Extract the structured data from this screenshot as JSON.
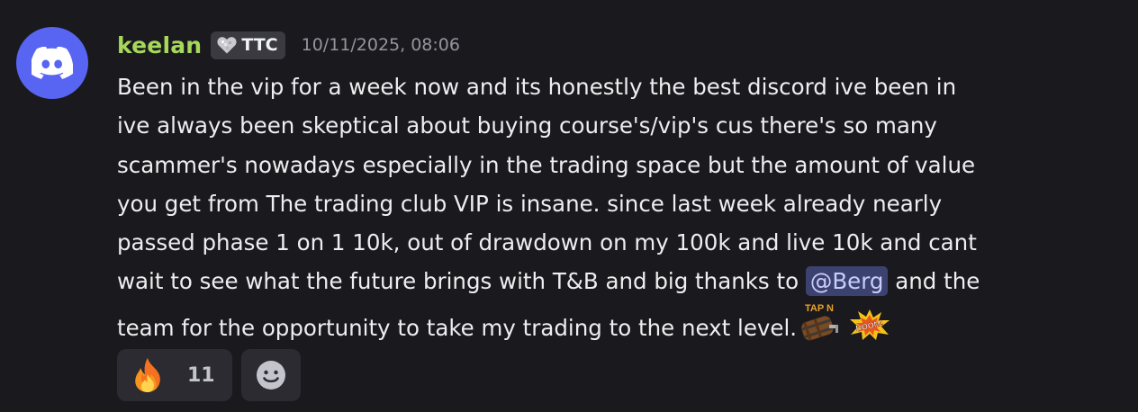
{
  "author": {
    "username": "keelan",
    "avatar_icon": "discord-logo-icon",
    "username_color": "#a6d85a",
    "avatar_color": "#5865f2"
  },
  "guild_tag": {
    "icon": "heart-badge-icon",
    "label": "TTC"
  },
  "timestamp": "10/11/2025, 08:06",
  "message": {
    "line1": "Been in the vip for a week now and its honestly the best discord ive been in",
    "line2": "ive always been skeptical about buying course's/vip's cus there's so many",
    "line3": "scammer's nowadays especially in the trading space but the amount of value",
    "line4": "you get from The trading club VIP is insane. since last week already nearly",
    "line5": "passed phase 1 on 1 10k, out of drawdown on my 100k and live 10k and cant",
    "line6_before": "wait to see what the future brings with T&B and big thanks to ",
    "mention": "@Berg",
    "line6_after": " and the",
    "line7": "team for the opportunity to take my trading to the next level.",
    "custom_emojis": [
      {
        "name": "tap-n-barrel-emoji",
        "text": "TAP N"
      },
      {
        "name": "boom-emoji",
        "text": "BOOM!"
      }
    ]
  },
  "reactions": [
    {
      "emoji": "fire-emoji",
      "count": "11"
    }
  ],
  "add_reaction_icon": "smiley-face-icon"
}
